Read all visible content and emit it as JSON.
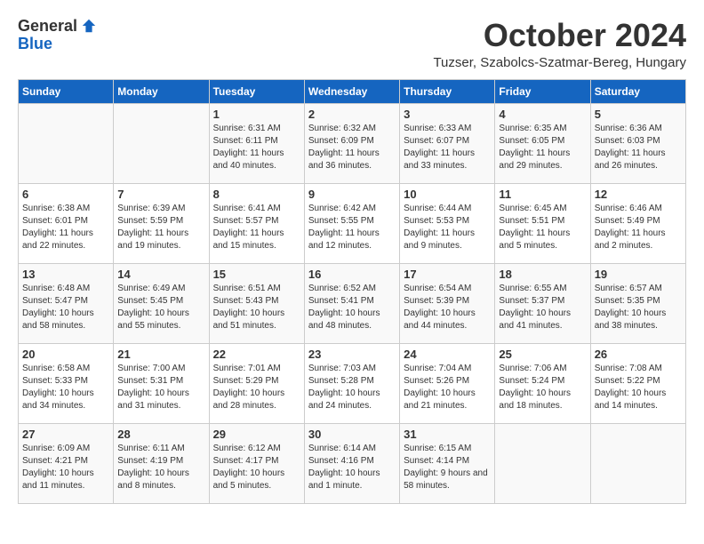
{
  "logo": {
    "general": "General",
    "blue": "Blue"
  },
  "title": "October 2024",
  "location": "Tuzser, Szabolcs-Szatmar-Bereg, Hungary",
  "weekdays": [
    "Sunday",
    "Monday",
    "Tuesday",
    "Wednesday",
    "Thursday",
    "Friday",
    "Saturday"
  ],
  "weeks": [
    [
      {
        "day": null
      },
      {
        "day": null
      },
      {
        "day": "1",
        "sunrise": "6:31 AM",
        "sunset": "6:11 PM",
        "daylight": "11 hours and 40 minutes."
      },
      {
        "day": "2",
        "sunrise": "6:32 AM",
        "sunset": "6:09 PM",
        "daylight": "11 hours and 36 minutes."
      },
      {
        "day": "3",
        "sunrise": "6:33 AM",
        "sunset": "6:07 PM",
        "daylight": "11 hours and 33 minutes."
      },
      {
        "day": "4",
        "sunrise": "6:35 AM",
        "sunset": "6:05 PM",
        "daylight": "11 hours and 29 minutes."
      },
      {
        "day": "5",
        "sunrise": "6:36 AM",
        "sunset": "6:03 PM",
        "daylight": "11 hours and 26 minutes."
      }
    ],
    [
      {
        "day": "6",
        "sunrise": "6:38 AM",
        "sunset": "6:01 PM",
        "daylight": "11 hours and 22 minutes."
      },
      {
        "day": "7",
        "sunrise": "6:39 AM",
        "sunset": "5:59 PM",
        "daylight": "11 hours and 19 minutes."
      },
      {
        "day": "8",
        "sunrise": "6:41 AM",
        "sunset": "5:57 PM",
        "daylight": "11 hours and 15 minutes."
      },
      {
        "day": "9",
        "sunrise": "6:42 AM",
        "sunset": "5:55 PM",
        "daylight": "11 hours and 12 minutes."
      },
      {
        "day": "10",
        "sunrise": "6:44 AM",
        "sunset": "5:53 PM",
        "daylight": "11 hours and 9 minutes."
      },
      {
        "day": "11",
        "sunrise": "6:45 AM",
        "sunset": "5:51 PM",
        "daylight": "11 hours and 5 minutes."
      },
      {
        "day": "12",
        "sunrise": "6:46 AM",
        "sunset": "5:49 PM",
        "daylight": "11 hours and 2 minutes."
      }
    ],
    [
      {
        "day": "13",
        "sunrise": "6:48 AM",
        "sunset": "5:47 PM",
        "daylight": "10 hours and 58 minutes."
      },
      {
        "day": "14",
        "sunrise": "6:49 AM",
        "sunset": "5:45 PM",
        "daylight": "10 hours and 55 minutes."
      },
      {
        "day": "15",
        "sunrise": "6:51 AM",
        "sunset": "5:43 PM",
        "daylight": "10 hours and 51 minutes."
      },
      {
        "day": "16",
        "sunrise": "6:52 AM",
        "sunset": "5:41 PM",
        "daylight": "10 hours and 48 minutes."
      },
      {
        "day": "17",
        "sunrise": "6:54 AM",
        "sunset": "5:39 PM",
        "daylight": "10 hours and 44 minutes."
      },
      {
        "day": "18",
        "sunrise": "6:55 AM",
        "sunset": "5:37 PM",
        "daylight": "10 hours and 41 minutes."
      },
      {
        "day": "19",
        "sunrise": "6:57 AM",
        "sunset": "5:35 PM",
        "daylight": "10 hours and 38 minutes."
      }
    ],
    [
      {
        "day": "20",
        "sunrise": "6:58 AM",
        "sunset": "5:33 PM",
        "daylight": "10 hours and 34 minutes."
      },
      {
        "day": "21",
        "sunrise": "7:00 AM",
        "sunset": "5:31 PM",
        "daylight": "10 hours and 31 minutes."
      },
      {
        "day": "22",
        "sunrise": "7:01 AM",
        "sunset": "5:29 PM",
        "daylight": "10 hours and 28 minutes."
      },
      {
        "day": "23",
        "sunrise": "7:03 AM",
        "sunset": "5:28 PM",
        "daylight": "10 hours and 24 minutes."
      },
      {
        "day": "24",
        "sunrise": "7:04 AM",
        "sunset": "5:26 PM",
        "daylight": "10 hours and 21 minutes."
      },
      {
        "day": "25",
        "sunrise": "7:06 AM",
        "sunset": "5:24 PM",
        "daylight": "10 hours and 18 minutes."
      },
      {
        "day": "26",
        "sunrise": "7:08 AM",
        "sunset": "5:22 PM",
        "daylight": "10 hours and 14 minutes."
      }
    ],
    [
      {
        "day": "27",
        "sunrise": "6:09 AM",
        "sunset": "4:21 PM",
        "daylight": "10 hours and 11 minutes."
      },
      {
        "day": "28",
        "sunrise": "6:11 AM",
        "sunset": "4:19 PM",
        "daylight": "10 hours and 8 minutes."
      },
      {
        "day": "29",
        "sunrise": "6:12 AM",
        "sunset": "4:17 PM",
        "daylight": "10 hours and 5 minutes."
      },
      {
        "day": "30",
        "sunrise": "6:14 AM",
        "sunset": "4:16 PM",
        "daylight": "10 hours and 1 minute."
      },
      {
        "day": "31",
        "sunrise": "6:15 AM",
        "sunset": "4:14 PM",
        "daylight": "9 hours and 58 minutes."
      },
      {
        "day": null
      },
      {
        "day": null
      }
    ]
  ]
}
